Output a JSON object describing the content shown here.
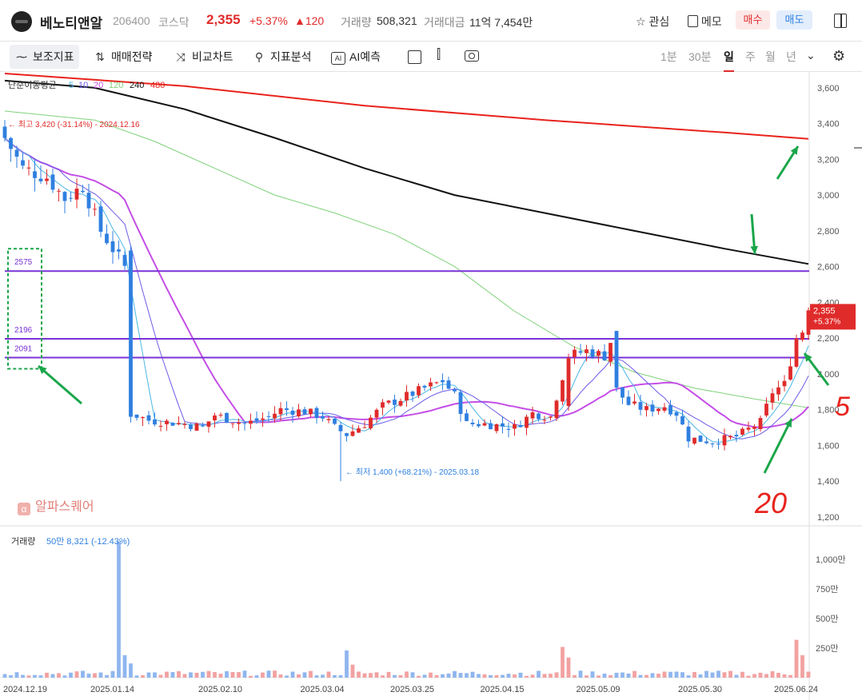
{
  "header": {
    "name": "베노티앤알",
    "code": "206400",
    "market": "코스닥",
    "price": "2,355",
    "change_pct": "+5.37%",
    "change_abs": "▲120",
    "volume_label": "거래량",
    "volume": "508,321",
    "amount_label": "거래대금",
    "amount": "11억 7,454만",
    "watch": "관심",
    "memo": "메모",
    "buy": "매수",
    "sell": "매도"
  },
  "toolbar": {
    "indicators": "보조지표",
    "strategy": "매매전략",
    "compare": "비교차트",
    "analysis": "지표분석",
    "ai": "AI예측",
    "timeframes": [
      "1분",
      "30분",
      "일",
      "주",
      "월",
      "년"
    ],
    "active_timeframe": "일"
  },
  "watermark": "알파스퀘어",
  "colors": {
    "up": "#e02b2b",
    "down": "#2f7fe0",
    "ma5": "#49b6e6",
    "ma10": "#6b5ce7",
    "ma20": "#c44ee6",
    "ma120": "#7fd27a",
    "ma240": "#111111",
    "ma480": "#e8231c",
    "hline": "#7a32d6",
    "volUp": "#f3a1a1",
    "volDown": "#8fb6ee"
  },
  "chart_data": {
    "type": "candlestick",
    "ma_legend": {
      "label": "단순이동평균",
      "periods": [
        "5",
        "10",
        "20",
        "120",
        "240",
        "480"
      ]
    },
    "x_ticks": [
      "2024.12.19",
      "2025.01.14",
      "2025.02.10",
      "2025.03.04",
      "2025.03.25",
      "2025.04.15",
      "2025.05.09",
      "2025.05.30",
      "2025.06.24"
    ],
    "y_ticks": [
      "3,600",
      "3,400",
      "3,200",
      "3,000",
      "2,800",
      "2,600",
      "2,400",
      "2,200",
      "2,000",
      "1,800",
      "1,600",
      "1,400",
      "1,200"
    ],
    "ylim": [
      1150,
      3680
    ],
    "last_price": {
      "price": "2,355",
      "pct": "+5.37%"
    },
    "high_annotation": "최고 3,420 (-31.14%) - 2024.12.16",
    "low_annotation": "최저 1,400 (+68.21%) - 2025.03.18",
    "hlines": [
      {
        "label": "2575",
        "value": 2575
      },
      {
        "label": "2196",
        "value": 2196
      },
      {
        "label": "2091",
        "value": 2091
      }
    ],
    "ma_lines": [
      {
        "period": 480,
        "x": [
          0,
          30,
          60,
          90,
          120,
          134
        ],
        "y": [
          3680,
          3610,
          3500,
          3420,
          3350,
          3315
        ]
      },
      {
        "period": 240,
        "x": [
          0,
          15,
          30,
          45,
          60,
          75,
          90,
          105,
          120,
          134
        ],
        "y": [
          3640,
          3600,
          3480,
          3320,
          3150,
          3000,
          2900,
          2800,
          2700,
          2615
        ]
      },
      {
        "period": 120,
        "x": [
          0,
          15,
          25,
          35,
          45,
          55,
          65,
          75,
          85,
          95,
          105,
          115,
          125,
          134
        ],
        "y": [
          3470,
          3420,
          3300,
          3150,
          3000,
          2900,
          2780,
          2600,
          2350,
          2150,
          2010,
          1920,
          1860,
          1810
        ]
      }
    ],
    "candles": [],
    "volume": {
      "label": "거래량",
      "current": "50만 8,321 (-12.43%)",
      "y_ticks": [
        "1,000만",
        "750만",
        "500만",
        "250만"
      ],
      "ylim": [
        0,
        11500000
      ]
    },
    "annotations": {
      "handwritten": [
        "5",
        "20"
      ]
    }
  }
}
